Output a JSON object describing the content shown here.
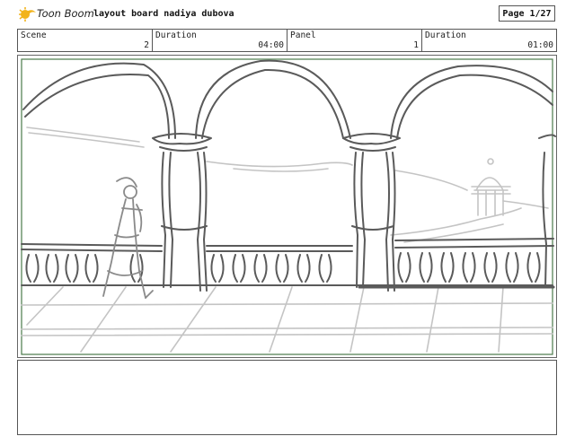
{
  "header": {
    "logo_text": "Toon Boom",
    "board_title": "layout board nadiya dubova",
    "page_label": "Page",
    "page_value": "1/27"
  },
  "info": [
    {
      "label": "Scene",
      "value": "2"
    },
    {
      "label": "Duration",
      "value": "04:00"
    },
    {
      "label": "Panel",
      "value": "1"
    },
    {
      "label": "Duration",
      "value": "01:00"
    }
  ],
  "colors": {
    "frame_border": "#4a7a4a",
    "sketch_dark": "#555555",
    "sketch_light": "#c4c4c4",
    "logo_accent": "#f2b31a"
  },
  "icons": {
    "logo": "toon-boom-logo-icon"
  }
}
